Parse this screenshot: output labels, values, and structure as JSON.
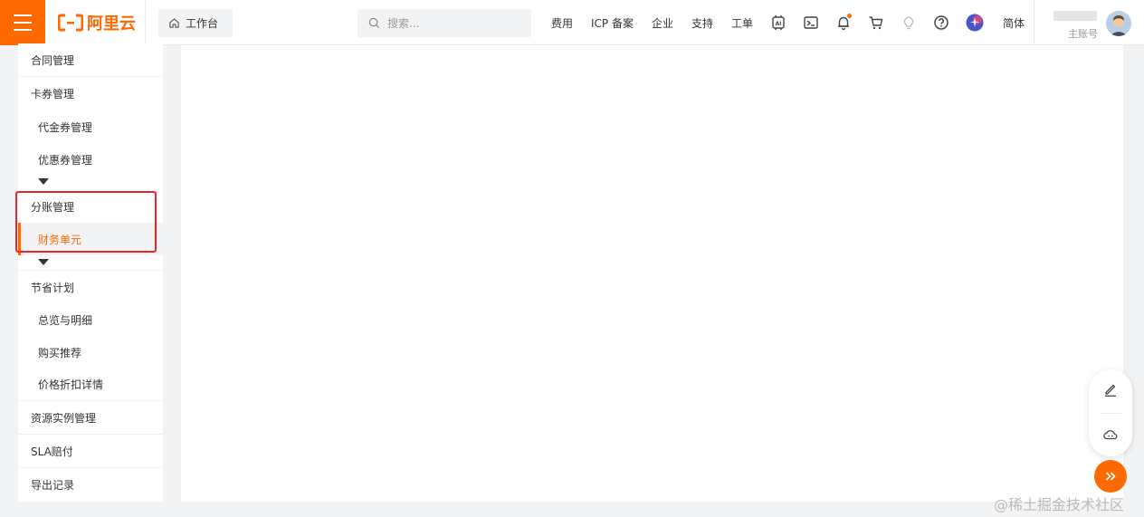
{
  "header": {
    "logo_text": "阿里云",
    "workbench_label": "工作台",
    "search_placeholder": "搜索...",
    "nav_links": [
      "费用",
      "ICP 备案",
      "企业",
      "支持",
      "工单"
    ],
    "language_label": "简体",
    "account_role": "主账号",
    "icons": [
      "menu-icon",
      "home-icon",
      "search-icon",
      "ai-assistant-icon",
      "terminal-icon",
      "bell-icon",
      "cart-icon",
      "lightbulb-icon",
      "help-icon",
      "star-badge-icon"
    ],
    "accent_color": "#ff6a00"
  },
  "sidebar": {
    "items": [
      {
        "label": "合同管理",
        "level": "top"
      },
      {
        "label": "卡券管理",
        "level": "top"
      },
      {
        "label": "代金券管理",
        "level": "sub"
      },
      {
        "label": "优惠券管理",
        "level": "sub"
      },
      {
        "label": "分账管理",
        "level": "top"
      },
      {
        "label": "财务单元",
        "level": "sub",
        "active": true
      },
      {
        "label": "节省计划",
        "level": "top"
      },
      {
        "label": "总览与明细",
        "level": "sub"
      },
      {
        "label": "购买推荐",
        "level": "sub"
      },
      {
        "label": "价格折扣详情",
        "level": "sub"
      },
      {
        "label": "资源实例管理",
        "level": "top"
      },
      {
        "label": "SLA赔付",
        "level": "top"
      },
      {
        "label": "导出记录",
        "level": "top"
      }
    ],
    "highlight_color": "#e8262a"
  },
  "floating_tools": {
    "icons": [
      "edit-icon",
      "cloud-icon",
      "double-chevron-right-icon"
    ]
  },
  "watermark": "@稀土掘金技术社区"
}
